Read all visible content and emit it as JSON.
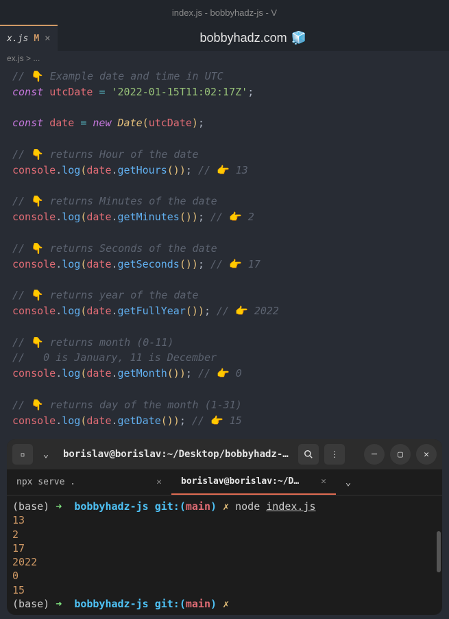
{
  "window": {
    "title": "index.js - bobbyhadz-js - V"
  },
  "tab": {
    "name": "x.js",
    "modified": "M",
    "close": "×"
  },
  "banner": {
    "text": "bobbyhadz.com",
    "icon": "🧊"
  },
  "breadcrumb": {
    "text": "ex.js > ..."
  },
  "code": {
    "l1_comment": "// 👇 Example date and time in UTC",
    "l2_const": "const",
    "l2_var": "utcDate",
    "l2_eq": "=",
    "l2_str": "'2022-01-15T11:02:17Z'",
    "l2_semi": ";",
    "l4_const": "const",
    "l4_var": "date",
    "l4_eq": "=",
    "l4_new": "new",
    "l4_class": "Date",
    "l4_arg": "utcDate",
    "l6_c": "// 👇 returns Hour of the date",
    "l7_obj": "console",
    "l7_m": "log",
    "l7_arg": "date",
    "l7_meth": "getHours",
    "l7_cmt": "// 👉 13",
    "l9_c": "// 👇 returns Minutes of the date",
    "l10_meth": "getMinutes",
    "l10_cmt": "// 👉 2",
    "l12_c": "// 👇 returns Seconds of the date",
    "l13_meth": "getSeconds",
    "l13_cmt": "// 👉 17",
    "l15_c": "// 👇 returns year of the date",
    "l16_meth": "getFullYear",
    "l16_cmt": "// 👉 2022",
    "l18_c": "// 👇 returns month (0-11)",
    "l19_c": "//   0 is January, 11 is December",
    "l20_meth": "getMonth",
    "l20_cmt": "// 👉 0",
    "l22_c": "// 👇 returns day of the month (1-31)",
    "l23_meth": "getDate",
    "l23_cmt": "// 👉 15"
  },
  "terminal": {
    "title": "borislav@borislav:~/Desktop/bobbyhadz-r…",
    "tabs": [
      {
        "label": "npx serve .",
        "active": false
      },
      {
        "label": "borislav@borislav:~/Desktop/b…",
        "active": true
      }
    ],
    "prompt": {
      "base": "(base)",
      "arrow": "➜",
      "dir": "bobbyhadz-js",
      "git": "git:",
      "lp": "(",
      "branch": "main",
      "rp": ")",
      "dirty": "✗",
      "cmd": "node",
      "file": "index.js"
    },
    "output": [
      "13",
      "2",
      "17",
      "2022",
      "0",
      "15"
    ]
  }
}
